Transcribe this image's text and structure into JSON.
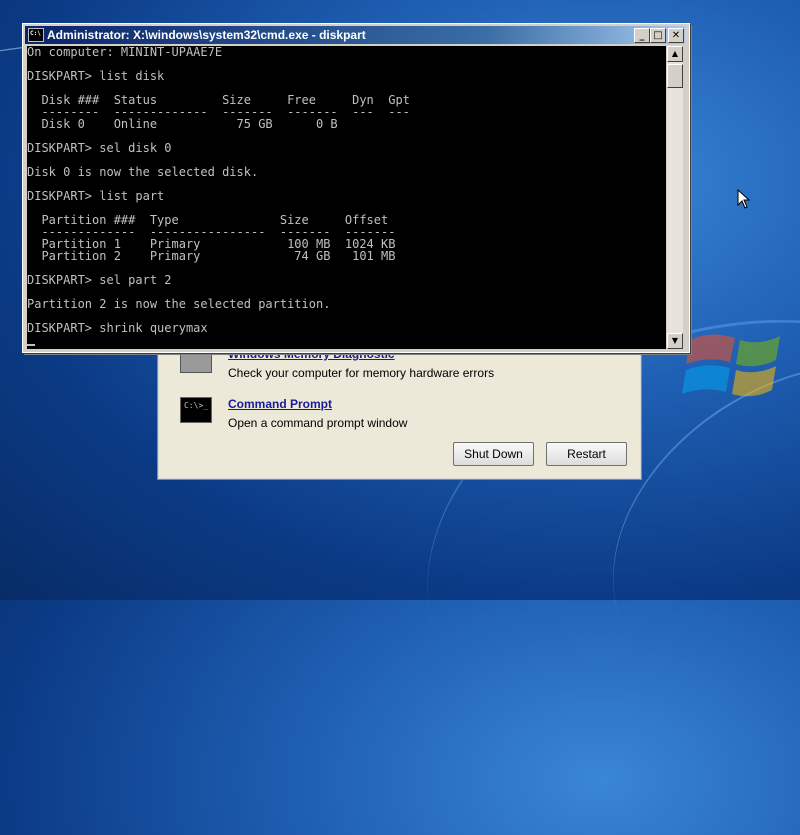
{
  "desktop": {
    "accent": "#1f5fb3"
  },
  "recovery_dialog": {
    "options": [
      {
        "icon": "memory-chip-icon",
        "link": "Windows Memory Diagnostic",
        "description": "Check your computer for memory hardware errors"
      },
      {
        "icon": "command-prompt-icon",
        "icon_text": "C:\\>_",
        "link": "Command Prompt",
        "description": "Open a command prompt window"
      }
    ],
    "shutdown_label": "Shut Down",
    "restart_label": "Restart"
  },
  "cmd_window": {
    "title": "Administrator: X:\\windows\\system32\\cmd.exe - diskpart",
    "icon_text": "C:\\",
    "minimize_glyph": "_",
    "maximize_glyph": "□",
    "close_glyph": "✕",
    "scroll_up_glyph": "▲",
    "scroll_down_glyph": "▼",
    "console_lines": [
      "On computer: MININT-UPAAE7E",
      "",
      "DISKPART> list disk",
      "",
      "  Disk ###  Status         Size     Free     Dyn  Gpt",
      "  --------  -------------  -------  -------  ---  ---",
      "  Disk 0    Online           75 GB      0 B",
      "",
      "DISKPART> sel disk 0",
      "",
      "Disk 0 is now the selected disk.",
      "",
      "DISKPART> list part",
      "",
      "  Partition ###  Type              Size     Offset",
      "  -------------  ----------------  -------  -------",
      "  Partition 1    Primary            100 MB  1024 KB",
      "  Partition 2    Primary             74 GB   101 MB",
      "",
      "DISKPART> sel part 2",
      "",
      "Partition 2 is now the selected partition.",
      "",
      "DISKPART> shrink querymax",
      ""
    ]
  }
}
